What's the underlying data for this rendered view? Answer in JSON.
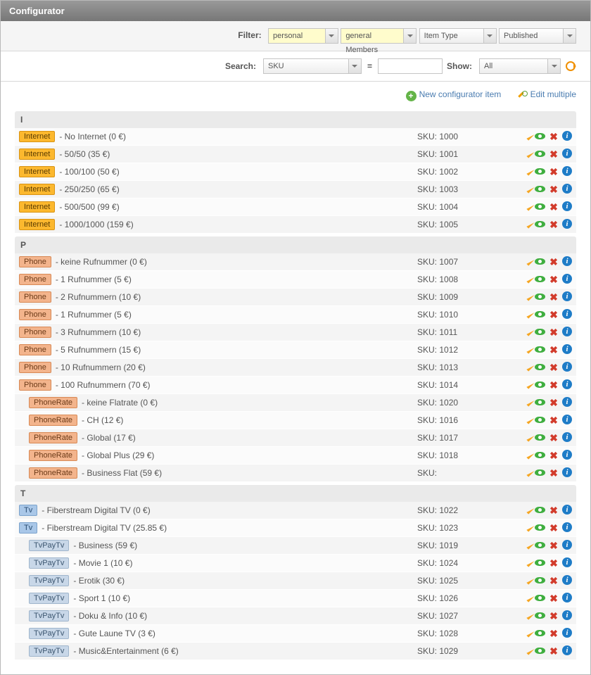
{
  "panel": {
    "title": "Configurator"
  },
  "filter": {
    "label": "Filter:",
    "f1": "personal",
    "f2": "general Members",
    "f3": "Item Type",
    "f4": "Published"
  },
  "search": {
    "label": "Search:",
    "field": "SKU",
    "value": "",
    "eq": "=",
    "showLabel": "Show:",
    "showValue": "All"
  },
  "toolbar": {
    "newItem": "New configurator item",
    "editMultiple": "Edit multiple"
  },
  "skuLabel": "SKU:",
  "groups": [
    {
      "letter": "I",
      "rows": [
        {
          "tagClass": "internet",
          "tag": "Internet",
          "desc": " - No Internet (0 €)",
          "sku": "1000",
          "indent": 0
        },
        {
          "tagClass": "internet",
          "tag": "Internet",
          "desc": " - 50/50 (35 €)",
          "sku": "1001",
          "indent": 0
        },
        {
          "tagClass": "internet",
          "tag": "Internet",
          "desc": " - 100/100 (50 €)",
          "sku": "1002",
          "indent": 0
        },
        {
          "tagClass": "internet",
          "tag": "Internet",
          "desc": " - 250/250 (65 €)",
          "sku": "1003",
          "indent": 0
        },
        {
          "tagClass": "internet",
          "tag": "Internet",
          "desc": " - 500/500 (99 €)",
          "sku": "1004",
          "indent": 0
        },
        {
          "tagClass": "internet",
          "tag": "Internet",
          "desc": " - 1000/1000 (159 €)",
          "sku": "1005",
          "indent": 0
        }
      ]
    },
    {
      "letter": "P",
      "rows": [
        {
          "tagClass": "phone",
          "tag": "Phone",
          "desc": " - keine Rufnummer (0 €)",
          "sku": "1007",
          "indent": 0
        },
        {
          "tagClass": "phone",
          "tag": "Phone",
          "desc": " - 1 Rufnummer (5 €)",
          "sku": "1008",
          "indent": 0
        },
        {
          "tagClass": "phone",
          "tag": "Phone",
          "desc": " - 2 Rufnummern (10 €)",
          "sku": "1009",
          "indent": 0
        },
        {
          "tagClass": "phone",
          "tag": "Phone",
          "desc": " - 1 Rufnummer (5 €)",
          "sku": "1010",
          "indent": 0
        },
        {
          "tagClass": "phone",
          "tag": "Phone",
          "desc": " - 3 Rufnummern (10 €)",
          "sku": "1011",
          "indent": 0
        },
        {
          "tagClass": "phone",
          "tag": "Phone",
          "desc": " - 5 Rufnummern (15 €)",
          "sku": "1012",
          "indent": 0
        },
        {
          "tagClass": "phone",
          "tag": "Phone",
          "desc": " - 10 Rufnummern (20 €)",
          "sku": "1013",
          "indent": 0
        },
        {
          "tagClass": "phone",
          "tag": "Phone",
          "desc": " - 100 Rufnummern (70 €)",
          "sku": "1014",
          "indent": 0
        },
        {
          "tagClass": "phonerate",
          "tag": "PhoneRate",
          "desc": " - keine Flatrate (0 €)",
          "sku": "1020",
          "indent": 1
        },
        {
          "tagClass": "phonerate",
          "tag": "PhoneRate",
          "desc": " - CH (12 €)",
          "sku": "1016",
          "indent": 1
        },
        {
          "tagClass": "phonerate",
          "tag": "PhoneRate",
          "desc": " - Global (17 €)",
          "sku": "1017",
          "indent": 1
        },
        {
          "tagClass": "phonerate",
          "tag": "PhoneRate",
          "desc": " - Global Plus (29 €)",
          "sku": "1018",
          "indent": 1
        },
        {
          "tagClass": "phonerate",
          "tag": "PhoneRate",
          "desc": " - Business Flat (59 €)",
          "sku": "",
          "indent": 1
        }
      ]
    },
    {
      "letter": "T",
      "rows": [
        {
          "tagClass": "tv",
          "tag": "Tv",
          "desc": " - Fiberstream Digital TV (0 €)",
          "sku": "1022",
          "indent": 0
        },
        {
          "tagClass": "tv",
          "tag": "Tv",
          "desc": " - Fiberstream Digital TV (25.85 €)",
          "sku": "1023",
          "indent": 0
        },
        {
          "tagClass": "tvpay",
          "tag": "TvPayTv",
          "desc": " - Business (59 €)",
          "sku": "1019",
          "indent": 1
        },
        {
          "tagClass": "tvpay",
          "tag": "TvPayTv",
          "desc": " - Movie 1 (10 €)",
          "sku": "1024",
          "indent": 1
        },
        {
          "tagClass": "tvpay",
          "tag": "TvPayTv",
          "desc": " - Erotik (30 €)",
          "sku": "1025",
          "indent": 1
        },
        {
          "tagClass": "tvpay",
          "tag": "TvPayTv",
          "desc": " - Sport 1 (10 €)",
          "sku": "1026",
          "indent": 1
        },
        {
          "tagClass": "tvpay",
          "tag": "TvPayTv",
          "desc": " - Doku & Info (10 €)",
          "sku": "1027",
          "indent": 1
        },
        {
          "tagClass": "tvpay",
          "tag": "TvPayTv",
          "desc": " - Gute Laune TV (3 €)",
          "sku": "1028",
          "indent": 1
        },
        {
          "tagClass": "tvpay",
          "tag": "TvPayTv",
          "desc": " - Music&Entertainment (6 €)",
          "sku": "1029",
          "indent": 1
        }
      ]
    }
  ]
}
